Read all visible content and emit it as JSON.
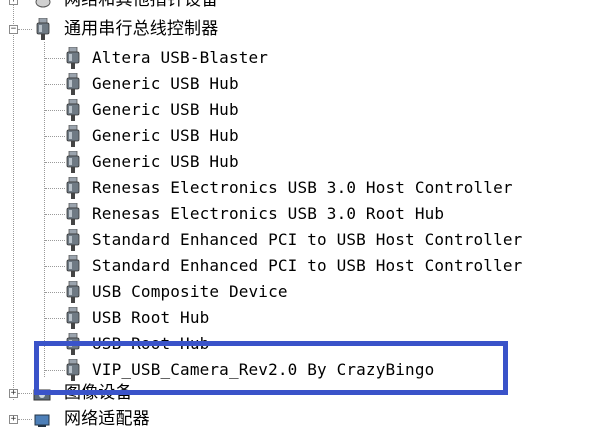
{
  "tree": {
    "top_partial_category": "网络和其他指针设备",
    "category": {
      "label": "通用串行总线控制器",
      "expander": "−",
      "children": [
        "Altera USB-Blaster",
        "Generic USB Hub",
        "Generic USB Hub",
        "Generic USB Hub",
        "Generic USB Hub",
        "Renesas Electronics USB 3.0 Host Controller",
        "Renesas Electronics USB 3.0 Root Hub",
        "Standard Enhanced PCI to USB Host Controller",
        "Standard Enhanced PCI to USB Host Controller",
        "USB Composite Device",
        "USB Root Hub",
        "USB Root Hub",
        "VIP_USB_Camera_Rev2.0 By CrazyBingo"
      ]
    },
    "next_categories": [
      {
        "label": "图像设备",
        "expander": "+"
      },
      {
        "label": "网络适配器",
        "expander": "+"
      }
    ]
  },
  "colors": {
    "highlight_border": "#3a53c9",
    "tree_line": "#9a9a9a"
  },
  "icons": {
    "device": "usb-plug-icon",
    "image_device": "camera-icon",
    "network": "network-adapter-icon"
  }
}
